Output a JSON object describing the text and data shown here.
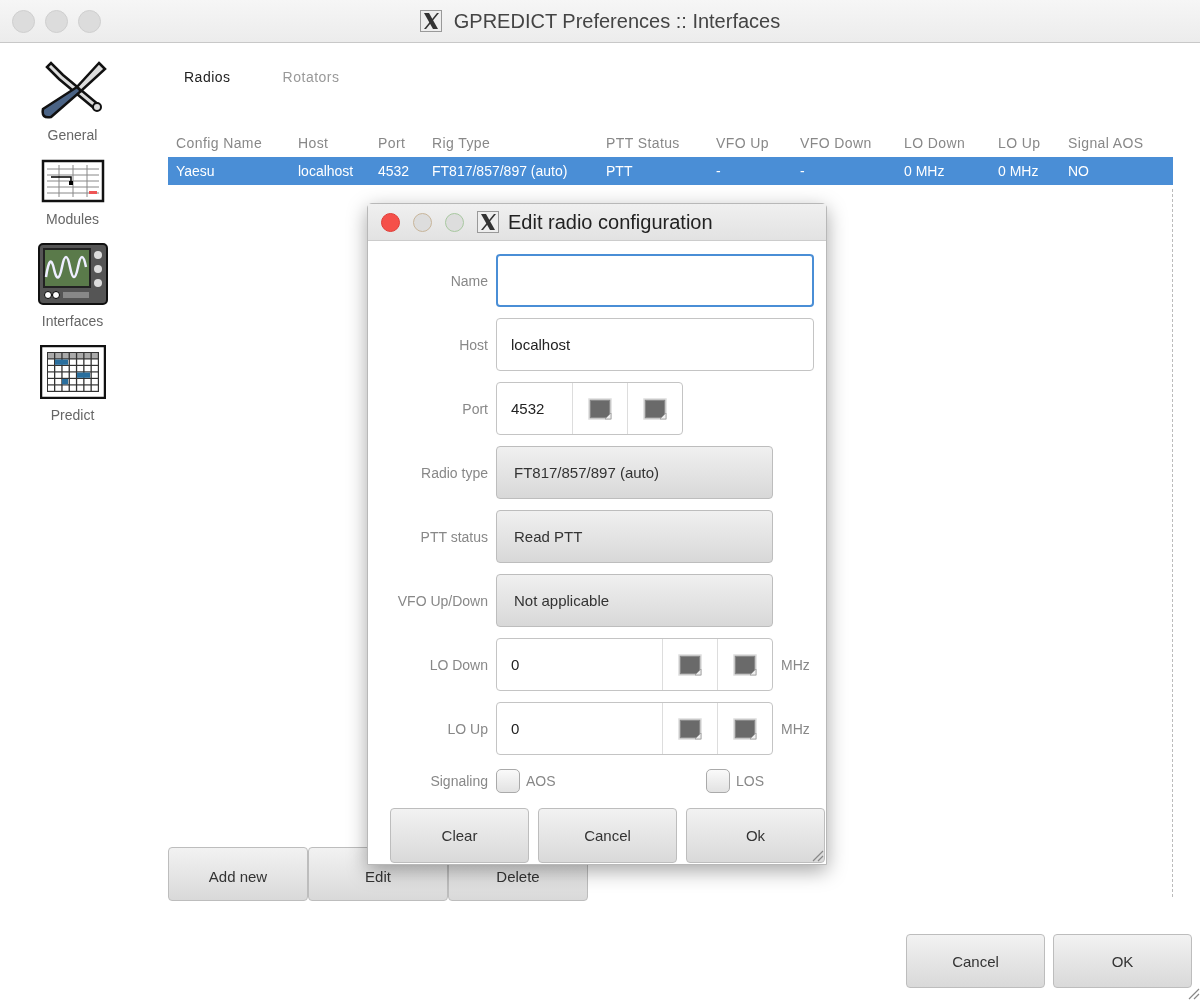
{
  "window": {
    "title": "GPREDICT Preferences :: Interfaces"
  },
  "sidebar": {
    "items": [
      {
        "label": "General",
        "kind": "tools"
      },
      {
        "label": "Modules",
        "kind": "sheet"
      },
      {
        "label": "Interfaces",
        "kind": "scope"
      },
      {
        "label": "Predict",
        "kind": "calendar"
      }
    ]
  },
  "tabs": [
    {
      "label": "Radios",
      "selected": true
    },
    {
      "label": "Rotators",
      "selected": false
    }
  ],
  "table": {
    "columns": [
      "Config Name",
      "Host",
      "Port",
      "Rig Type",
      "PTT Status",
      "VFO Up",
      "VFO Down",
      "LO Down",
      "LO Up",
      "Signal AOS"
    ],
    "rows": [
      {
        "cells": [
          "Yaesu",
          "localhost",
          "4532",
          "FT817/857/897 (auto)",
          "PTT",
          "-",
          "-",
          "0 MHz",
          "0 MHz",
          "NO"
        ],
        "selected": true
      }
    ]
  },
  "list_buttons": [
    "Add new",
    "Edit",
    "Delete"
  ],
  "dialog": {
    "title": "Edit radio configuration",
    "fields": [
      {
        "kind": "entry",
        "label": "Name",
        "focused": true
      },
      {
        "kind": "entry",
        "label": "Host",
        "value": "localhost",
        "focused": false
      },
      {
        "kind": "spin",
        "label": "Port",
        "value": "4532"
      },
      {
        "kind": "combo",
        "label": "Radio type",
        "value": "FT817/857/897 (auto)"
      },
      {
        "kind": "combo",
        "label": "PTT status",
        "value": "Read PTT"
      },
      {
        "kind": "combo",
        "label": "VFO Up/Down",
        "value": "Not applicable"
      },
      {
        "kind": "spin-unit",
        "label": "LO Down",
        "value": "0",
        "unit": "MHz"
      },
      {
        "kind": "spin-unit",
        "label": "LO Up",
        "value": "0",
        "unit": "MHz"
      }
    ],
    "signaling": {
      "label": "Signaling",
      "checks": [
        {
          "label": "AOS",
          "checked": false
        },
        {
          "label": "LOS",
          "checked": false
        }
      ]
    },
    "buttons": [
      "Clear",
      "Cancel",
      "Ok"
    ]
  },
  "buttons": [
    "Cancel",
    "OK"
  ]
}
